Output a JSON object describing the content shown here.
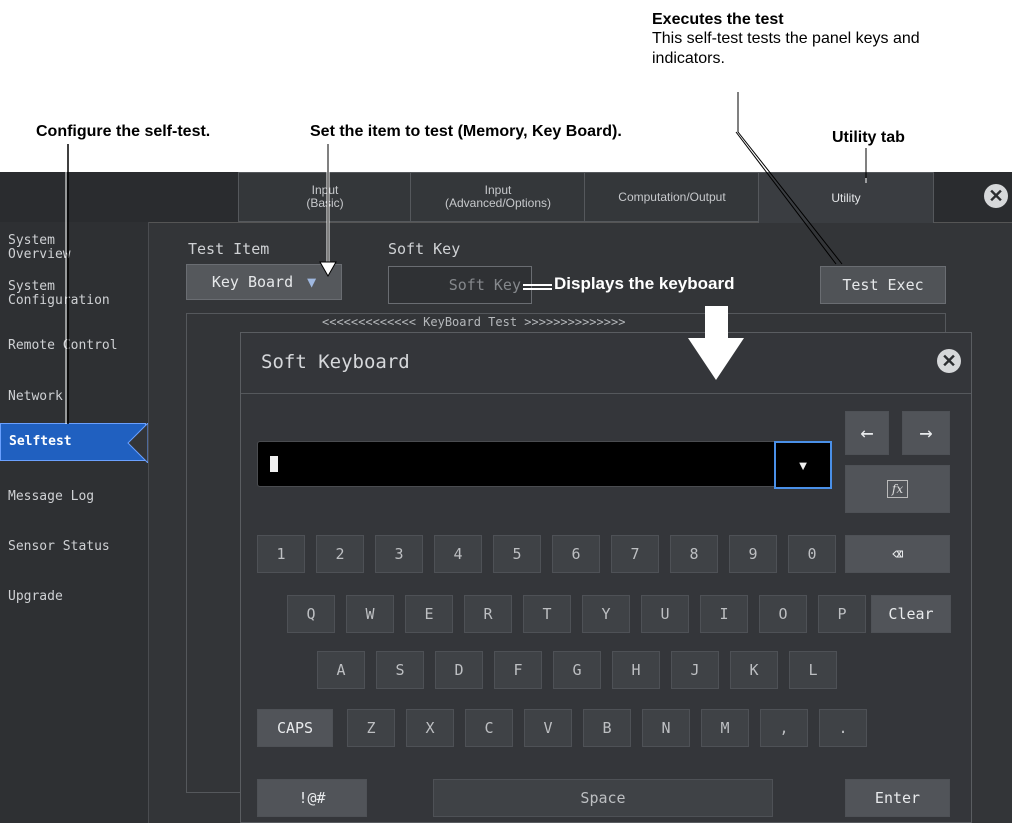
{
  "annotations": {
    "exec_title": "Executes the test",
    "exec_desc1": "This self-test tests the panel keys and",
    "exec_desc2": "indicators.",
    "configure": "Configure the self-test.",
    "set_item": "Set the item to test (Memory, Key Board).",
    "utility_tab": "Utility tab",
    "displays_keyboard": "Displays the keyboard"
  },
  "tabs": [
    {
      "label": "Input\n(Basic)"
    },
    {
      "label": "Input\n(Advanced/Options)"
    },
    {
      "label": "Computation/Output"
    },
    {
      "label": "Utility"
    }
  ],
  "sidebar": {
    "items": [
      {
        "label": "System\nOverview"
      },
      {
        "label": "System\nConfiguration"
      },
      {
        "label": "Remote Control"
      },
      {
        "label": "Network"
      },
      {
        "label": "Selftest"
      },
      {
        "label": "Message Log"
      },
      {
        "label": "Sensor Status"
      },
      {
        "label": "Upgrade"
      }
    ]
  },
  "main": {
    "test_item_label": "Test Item",
    "test_item_value": "Key Board",
    "soft_key_label": "Soft Key",
    "soft_key_button": "Soft Key",
    "test_exec_button": "Test Exec",
    "banner": "<<<<<<<<<<<<< KeyBoard Test >>>>>>>>>>>>>>"
  },
  "keyboard": {
    "title": "Soft Keyboard",
    "input_value": "",
    "row1": [
      "1",
      "2",
      "3",
      "4",
      "5",
      "6",
      "7",
      "8",
      "9",
      "0"
    ],
    "row2": [
      "Q",
      "W",
      "E",
      "R",
      "T",
      "Y",
      "U",
      "I",
      "O",
      "P"
    ],
    "clear_label": "Clear",
    "row3": [
      "A",
      "S",
      "D",
      "F",
      "G",
      "H",
      "J",
      "K",
      "L"
    ],
    "caps_label": "CAPS",
    "row4": [
      "Z",
      "X",
      "C",
      "V",
      "B",
      "N",
      "M",
      ",",
      "."
    ],
    "symbols_label": "!@#",
    "space_label": "Space",
    "enter_label": "Enter",
    "fx_label": "fx"
  },
  "colors": {
    "selected_blue": "#2060c0",
    "screen_bg": "#333538"
  }
}
